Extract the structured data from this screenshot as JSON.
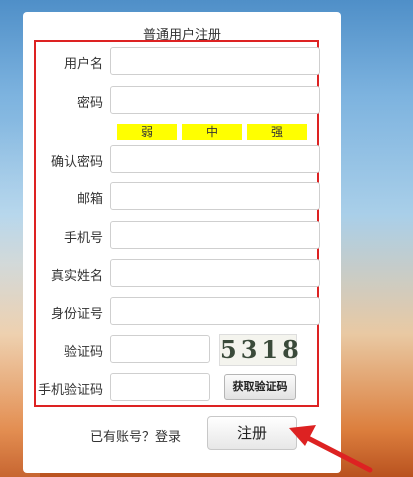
{
  "form": {
    "title": "普通用户注册",
    "fields": {
      "username": "用户名",
      "password": "密码",
      "confirm_password": "确认密码",
      "email": "邮箱",
      "phone": "手机号",
      "real_name": "真实姓名",
      "id_number": "身份证号",
      "captcha": "验证码",
      "sms_code": "手机验证码"
    },
    "strength": {
      "weak": "弱",
      "medium": "中",
      "strong": "强"
    },
    "captcha_text": "5318",
    "sms_button": "获取验证码",
    "have_account": "已有账号？登录",
    "register_button": "注册"
  },
  "colors": {
    "annotation_red": "#dd2222",
    "strength_yellow": "#ffff00"
  },
  "icons": {
    "annotation_arrow": "arrow-icon"
  }
}
